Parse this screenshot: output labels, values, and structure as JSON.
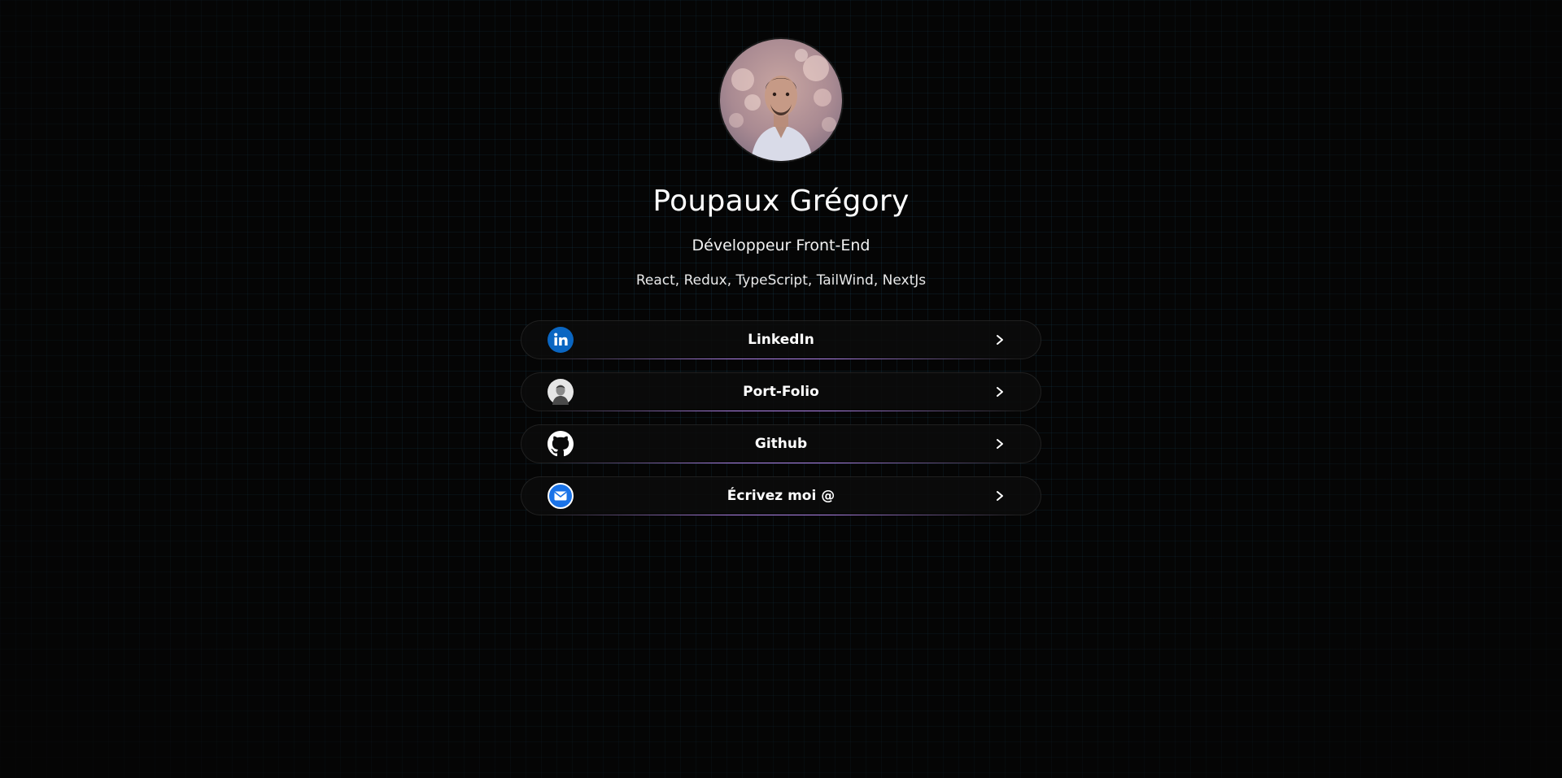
{
  "profile": {
    "name": "Poupaux Grégory",
    "role": "Développeur Front-End",
    "stack": "React, Redux, TypeScript, TailWind, NextJs"
  },
  "links": [
    {
      "label": "LinkedIn",
      "icon": "linkedin-icon"
    },
    {
      "label": "Port-Folio",
      "icon": "portfolio-avatar-icon"
    },
    {
      "label": "Github",
      "icon": "github-icon"
    },
    {
      "label": "Écrivez moi @",
      "icon": "email-icon"
    }
  ],
  "colors": {
    "background": "#050505",
    "grid": "#286e96",
    "accent_glow": "#be8cff",
    "linkedin_blue": "#0a66c2",
    "email_blue": "#1a73e8"
  }
}
